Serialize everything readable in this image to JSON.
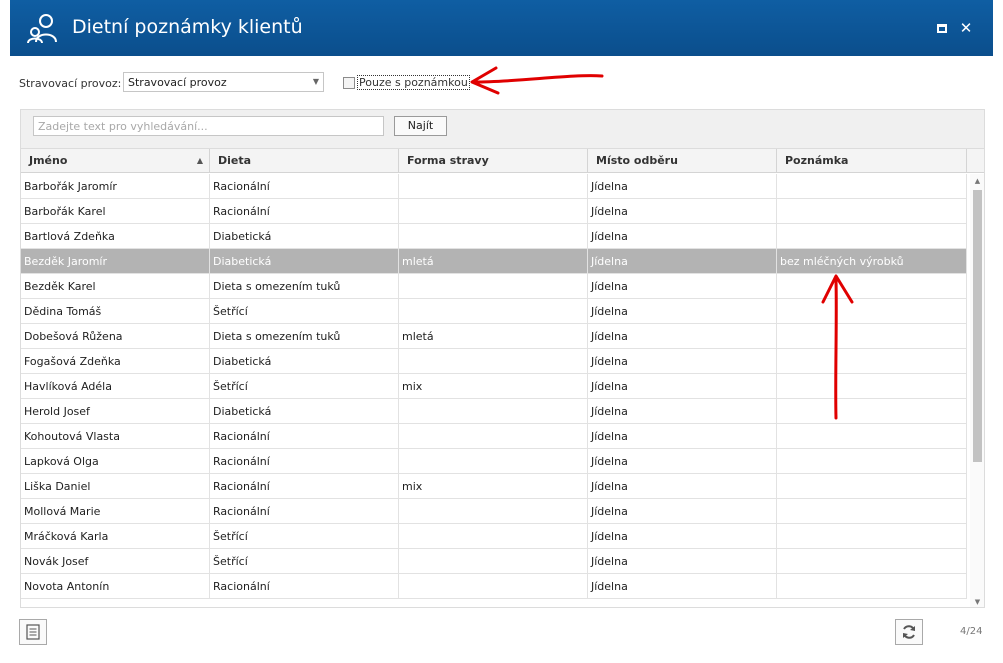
{
  "window": {
    "title": "Dietní poznámky klientů",
    "icons": {
      "app": "people-icon",
      "maximize": "maximize-icon",
      "close": "close-icon"
    }
  },
  "filter": {
    "label": "Stravovací provoz:",
    "selected": "Stravovací provoz",
    "checkbox_label": "Pouze s poznámkou",
    "checkbox_checked": false
  },
  "search": {
    "placeholder": "Zadejte text pro vyhledávání...",
    "button_label": "Najít"
  },
  "table": {
    "columns": [
      "Jméno",
      "Dieta",
      "Forma stravy",
      "Místo odběru",
      "Poznámka"
    ],
    "sorted_column": "Jméno",
    "sort_direction": "ascending",
    "rows": [
      [
        "Barbořák Jaromír",
        "Racionální",
        "",
        "Jídelna",
        ""
      ],
      [
        "Barbořák Karel",
        "Racionální",
        "",
        "Jídelna",
        ""
      ],
      [
        "Bartlová Zdeňka",
        "Diabetická",
        "",
        "Jídelna",
        ""
      ],
      [
        "Bezděk Jaromír",
        "Diabetická",
        "mletá",
        "Jídelna",
        "bez mléčných výrobků"
      ],
      [
        "Bezděk Karel",
        "Dieta s omezením tuků",
        "",
        "Jídelna",
        ""
      ],
      [
        "Dědina Tomáš",
        "Šetřící",
        "",
        "Jídelna",
        ""
      ],
      [
        "Dobešová Růžena",
        "Dieta s omezením tuků",
        "mletá",
        "Jídelna",
        ""
      ],
      [
        "Fogašová Zdeňka",
        "Diabetická",
        "",
        "Jídelna",
        ""
      ],
      [
        "Havlíková Adéla",
        "Šetřící",
        "mix",
        "Jídelna",
        ""
      ],
      [
        "Herold Josef",
        "Diabetická",
        "",
        "Jídelna",
        ""
      ],
      [
        "Kohoutová Vlasta",
        "Racionální",
        "",
        "Jídelna",
        ""
      ],
      [
        "Lapková Olga",
        "Racionální",
        "",
        "Jídelna",
        ""
      ],
      [
        "Liška Daniel",
        "Racionální",
        "mix",
        "Jídelna",
        ""
      ],
      [
        "Mollová Marie",
        "Racionální",
        "",
        "Jídelna",
        ""
      ],
      [
        "Mráčková Karla",
        "Šetřící",
        "",
        "Jídelna",
        ""
      ],
      [
        "Novák Josef",
        "Šetřící",
        "",
        "Jídelna",
        ""
      ],
      [
        "Novota Antonín",
        "Racionální",
        "",
        "Jídelna",
        ""
      ]
    ],
    "selected_row_index": 3
  },
  "footer": {
    "page_counter": "4/24",
    "icons": {
      "export": "document-icon",
      "refresh": "refresh-icon"
    }
  },
  "colors": {
    "titlebar": "#0b4e8c",
    "selected_row": "#b3b3b3",
    "annotation_arrow": "#e00000"
  }
}
